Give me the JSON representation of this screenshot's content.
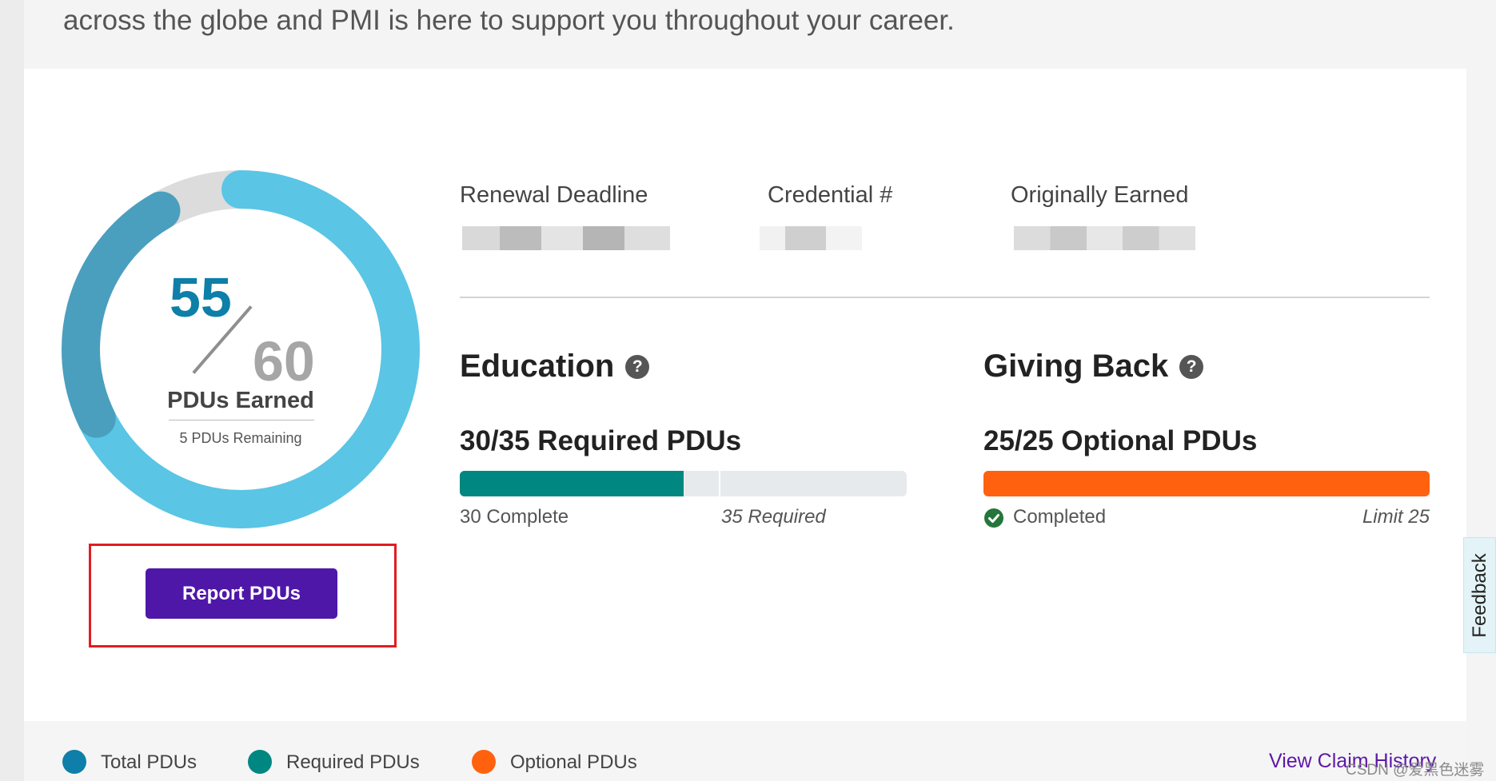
{
  "intro": {
    "text": "across the globe and PMI is here to support you throughout your career."
  },
  "progress": {
    "earned": "55",
    "total": "60",
    "earned_fraction": 0.9167,
    "label": "PDUs Earned",
    "remaining": "5 PDUs Remaining"
  },
  "report_button": {
    "label": "Report PDUs"
  },
  "info": {
    "renewal_label": "Renewal Deadline",
    "credential_label": "Credential #",
    "originally_label": "Originally Earned"
  },
  "education": {
    "title": "Education",
    "summary": "30/35 Required PDUs",
    "complete_label": "30 Complete",
    "required_label": "35 Required",
    "fill_fraction": 0.5,
    "marker_fraction": 0.58,
    "color": "#008781"
  },
  "giving_back": {
    "title": "Giving Back",
    "summary": "25/25 Optional PDUs",
    "status_label": "Completed",
    "limit_label": "Limit 25",
    "fill_fraction": 1.0,
    "color": "#ff610f"
  },
  "feedback": {
    "label": "Feedback"
  },
  "legend": {
    "items": [
      {
        "label": "Total PDUs",
        "color": "#0d7fa8"
      },
      {
        "label": "Required PDUs",
        "color": "#008781"
      },
      {
        "label": "Optional PDUs",
        "color": "#ff610f"
      }
    ],
    "view_claim_history": "View Claim History"
  },
  "watermark": {
    "text": "CSDN @爱黑色迷雾"
  },
  "icons": {
    "help": "question-circle-icon",
    "status": "check-circle-icon"
  }
}
